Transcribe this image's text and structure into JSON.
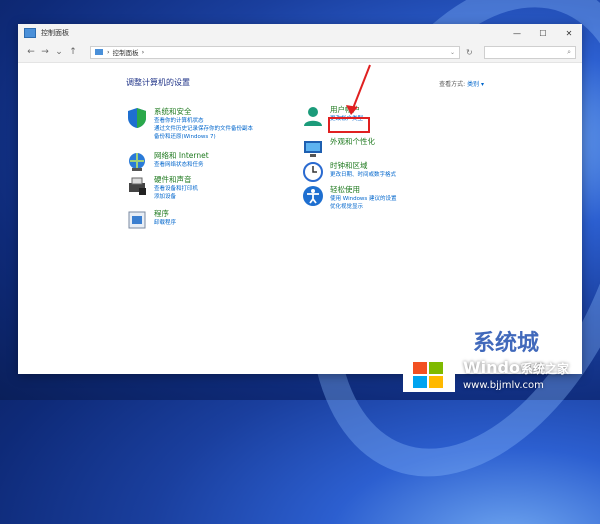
{
  "window": {
    "title": "控制面板",
    "controls": [
      "—",
      "☐",
      "✕"
    ]
  },
  "addressbar": {
    "path": "控制面板",
    "sep": "›",
    "back": "←",
    "forward": "→",
    "recent": "⌄",
    "up": "↑",
    "dropdown": "⌄",
    "refresh": "↻",
    "search_icon": "⌕"
  },
  "main": {
    "heading": "调整计算机的设置",
    "view_label": "查看方式:",
    "view_value": "类别 ▾"
  },
  "categories_left": [
    {
      "title": "系统和安全",
      "links": [
        "查看你的计算机状态",
        "通过文件历史记录保存你的文件备份副本",
        "备份和还原(Windows 7)"
      ],
      "icon": "shield-icon"
    },
    {
      "title": "网络和 Internet",
      "links": [
        "查看网络状态和任务"
      ],
      "icon": "network-icon"
    },
    {
      "title": "硬件和声音",
      "links": [
        "查看设备和打印机",
        "添加设备"
      ],
      "icon": "printer-icon"
    },
    {
      "title": "程序",
      "links": [
        "卸载程序"
      ],
      "icon": "programs-icon"
    }
  ],
  "categories_right": [
    {
      "title": "用户帐户",
      "links": [
        "更改帐户类型"
      ],
      "icon": "user-icon"
    },
    {
      "title": "外观和个性化",
      "links": [],
      "icon": "appearance-icon"
    },
    {
      "title": "时钟和区域",
      "links": [
        "更改日期、时间或数字格式"
      ],
      "icon": "clock-icon"
    },
    {
      "title": "轻松使用",
      "links": [
        "使用 Windows 建议的设置",
        "优化视觉显示"
      ],
      "icon": "accessibility-icon"
    }
  ],
  "watermark": {
    "brand": "Windows",
    "brand2": "系统之家",
    "url": "www.bjjmlv.com",
    "large": "系统城"
  },
  "colors": {
    "category_title": "#1f7a1f",
    "link": "#0066cc",
    "highlight": "#e02020"
  }
}
